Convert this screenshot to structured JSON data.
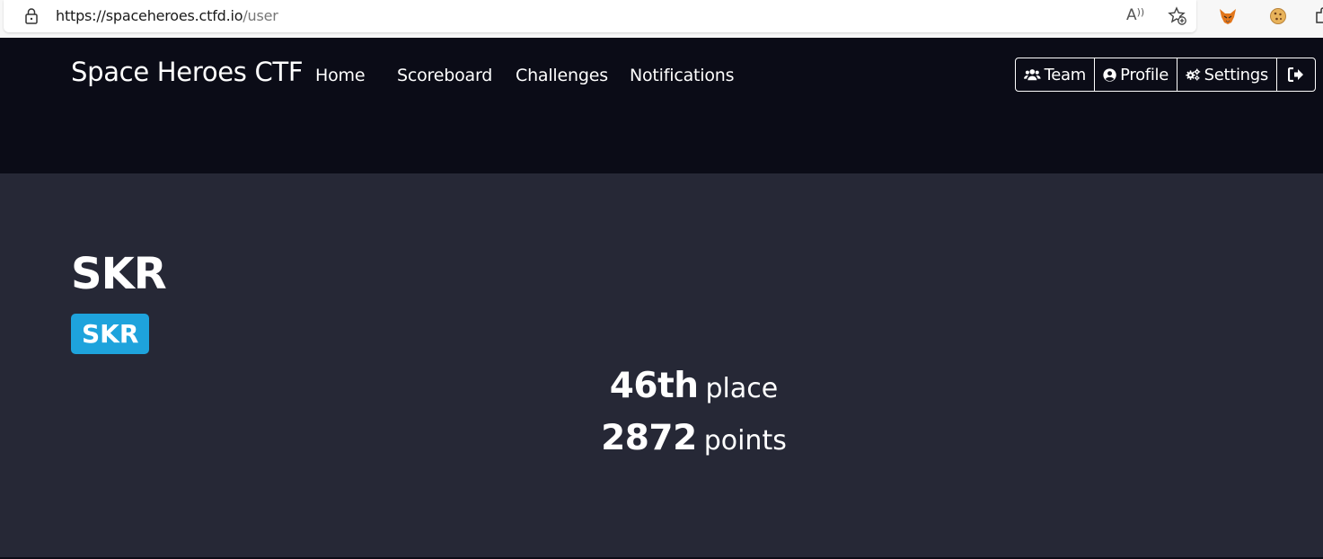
{
  "browser": {
    "url_host": "https://spaceheroes.ctfd.io",
    "url_path": "/user",
    "icons": [
      "lock-icon",
      "read-aloud-icon",
      "favorite-icon",
      "fox-extension-icon",
      "cookie-extension-icon",
      "puzzle-extension-icon"
    ]
  },
  "navbar": {
    "brand": "Space Heroes CTF",
    "links": [
      "Home",
      "Scoreboard",
      "Challenges",
      "Notifications"
    ],
    "buttons": {
      "team": "Team",
      "profile": "Profile",
      "settings": "Settings"
    }
  },
  "user": {
    "name": "SKR",
    "team_badge": "SKR",
    "place_value": "46th",
    "place_label": "place",
    "points_value": "2872",
    "points_label": "points"
  },
  "colors": {
    "header_bg": "#0b0c17",
    "main_bg": "#262836",
    "badge_bg": "#1ea3dc",
    "text": "#ffffff"
  }
}
